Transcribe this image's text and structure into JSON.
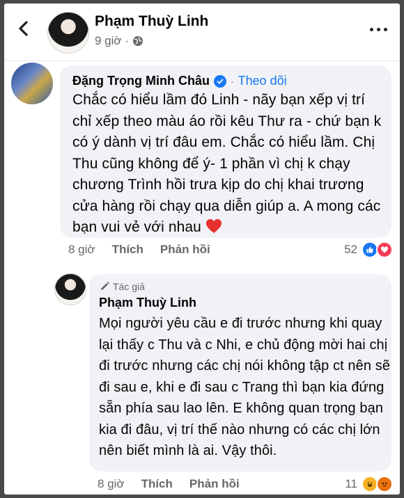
{
  "post": {
    "author": "Phạm Thuỳ Linh",
    "time": "9 giờ",
    "privacy_icon": "globe-icon"
  },
  "comment1": {
    "author": "Đặng Trọng Minh Châu",
    "verified": true,
    "separator": "·",
    "follow_label": "Theo dõi",
    "text": "Chắc có hiểu lầm đó Linh - nãy bạn xếp vị trí chỉ xếp theo màu áo rồi kêu Thư ra - chứ bạn k có ý dành vị trí đâu em. Chắc có hiểu lầm. Chị Thu cũng không để ý- 1 phần vì chị k chạy chương Trình hồi trưa kịp do chị khai trương cửa hàng rồi chạy qua diễn giúp a. A mong các bạn vui vẻ với nhau",
    "emoji": "heart",
    "time": "8 giờ",
    "like_label": "Thích",
    "reply_label": "Phản hồi",
    "reaction_count": "52",
    "reactions": [
      "like",
      "love"
    ]
  },
  "reply1": {
    "badge": "Tác giả",
    "author": "Phạm Thuỳ Linh",
    "text": "Mọi người yêu cầu e đi trước nhưng khi quay lại thấy c Thu và c Nhi, e chủ động mời hai chị đi trước nhưng các chị nói không tập ct nên sẽ đi sau e, khi e đi sau c Trang thì bạn kia đứng sẵn phía sau lao lên. E không quan trọng bạn kia đi đâu, vị trí thế nào nhưng có các chị lớn nên biết mình là ai. Vậy thôi.",
    "time": "8 giờ",
    "like_label": "Thích",
    "reply_label": "Phản hồi",
    "reaction_count": "11",
    "reactions": [
      "haha",
      "angry"
    ]
  },
  "colors": {
    "accent": "#1877f2",
    "bubble": "#f0f2f5",
    "meta": "#65676b"
  }
}
